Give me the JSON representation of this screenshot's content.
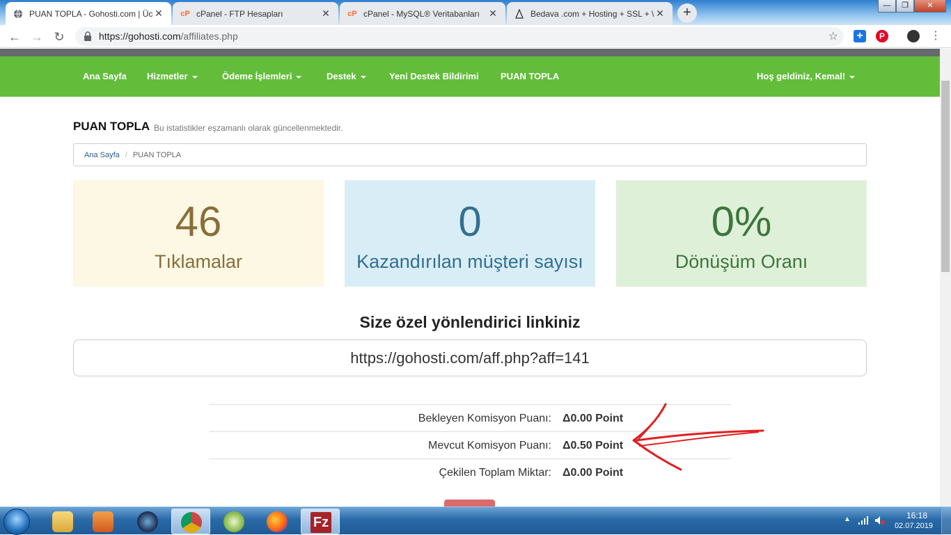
{
  "browser": {
    "tabs": [
      {
        "title": "PUAN TOPLA - Gohosti.com | Ücr",
        "icon": "globe-icon",
        "active": true
      },
      {
        "title": "cPanel - FTP Hesapları",
        "icon": "cpanel-icon",
        "active": false
      },
      {
        "title": "cPanel - MySQL® Veritabanları",
        "icon": "cpanel-icon",
        "active": false
      },
      {
        "title": "Bedava .com + Hosting + SSL + \\",
        "icon": "wizard-icon",
        "active": false
      }
    ],
    "url_domain": "https://gohosti.com",
    "url_path": "/affiliates.php",
    "window_buttons": {
      "minimize": "—",
      "maximize": "❐",
      "close": "✕"
    }
  },
  "nav": {
    "items": [
      {
        "label": "Ana Sayfa",
        "dropdown": false
      },
      {
        "label": "Hizmetler",
        "dropdown": true
      },
      {
        "label": "Ödeme İşlemleri",
        "dropdown": true
      },
      {
        "label": "Destek",
        "dropdown": true
      },
      {
        "label": "Yeni Destek Bildirimi",
        "dropdown": false
      },
      {
        "label": "PUAN TOPLA",
        "dropdown": false
      }
    ],
    "user_menu": "Hoş geldiniz, Kemal!",
    "bar_color": "#63bd3b"
  },
  "header": {
    "title": "PUAN TOPLA",
    "subtitle": "Bu istatistikler eşzamanlı olarak güncellenmektedir."
  },
  "breadcrumb": {
    "home": "Ana Sayfa",
    "separator": "/",
    "current": "PUAN TOPLA"
  },
  "stats": [
    {
      "value": "46",
      "label": "Tıklamalar",
      "bg": "#fcf8e3",
      "color": "#8a6d3b"
    },
    {
      "value": "0",
      "label": "Kazandırılan müşteri sayısı",
      "bg": "#d9edf7",
      "color": "#31708f"
    },
    {
      "value": "0%",
      "label": "Dönüşüm Oranı",
      "bg": "#dff0d8",
      "color": "#3c763d"
    }
  ],
  "referral": {
    "heading": "Size özel yönlendirici linkiniz",
    "link": "https://gohosti.com/aff.php?aff=141"
  },
  "commissions": [
    {
      "label": "Bekleyen Komisyon Puanı:",
      "value": "Δ0.00 Point"
    },
    {
      "label": "Mevcut Komisyon Puanı:",
      "value": "Δ0.50 Point"
    },
    {
      "label": "Çekilen Toplam Miktar:",
      "value": "Δ0.00 Point"
    }
  ],
  "annotation": {
    "color": "#e02020"
  },
  "taskbar": {
    "apps": [
      "explorer-icon",
      "media-player-icon",
      "cinema4d-icon",
      "chrome-icon",
      "rhino-icon",
      "firefox-icon",
      "filezilla-icon"
    ],
    "time": "16:18",
    "date": "02.07.2019"
  }
}
